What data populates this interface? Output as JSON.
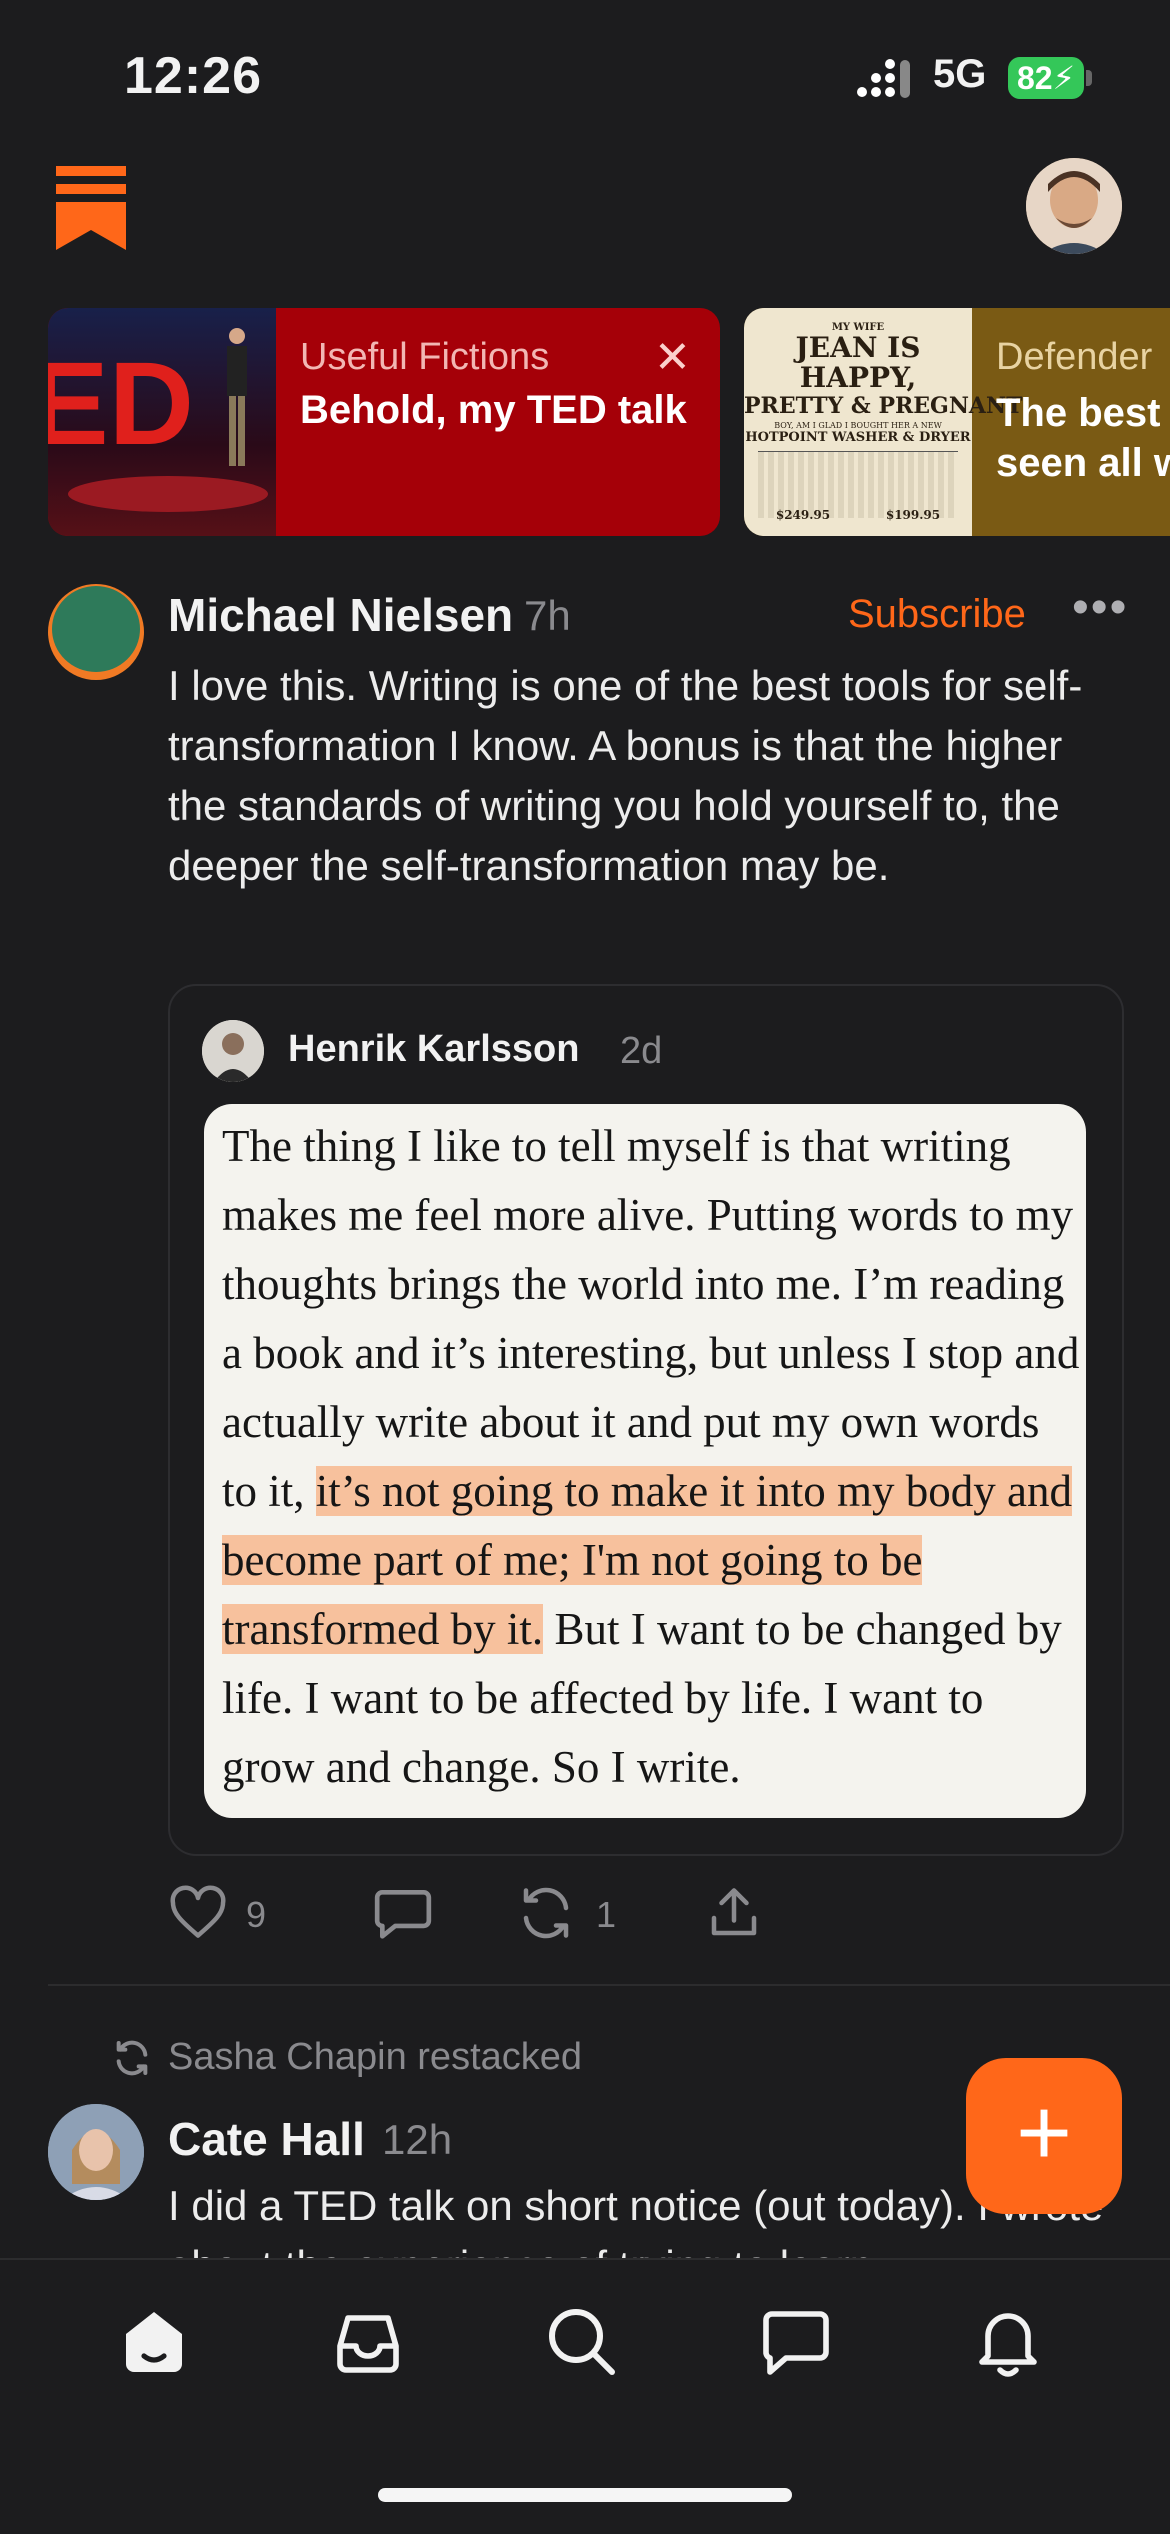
{
  "status_bar": {
    "time": "12:26",
    "network": "5G",
    "battery": "82"
  },
  "featured_cards": [
    {
      "publication": "Useful Fictions",
      "title": "Behold, my TED talk",
      "thumb_text": "ED",
      "close": "✕"
    },
    {
      "publication": "Defender",
      "title_line1": "The best",
      "title_line2": "seen all w",
      "ad_lines": [
        "MY WIFE",
        "JEAN IS HAPPY,",
        "PRETTY & PREGNANT",
        "BOY, AM I GLAD I BOUGHT HER A NEW",
        "HOTPOINT WASHER & DRYER",
        "$249.95",
        "$199.95"
      ]
    }
  ],
  "post": {
    "author": "Michael Nielsen",
    "time_ago": "7h",
    "subscribe_label": "Subscribe",
    "more_label": "•••",
    "text": "I love this. Writing is one of the best tools for self-transformation I know. A bonus is that the higher the standards of writing you hold yourself to, the deeper the self-transformation may be.",
    "quote": {
      "author": "Henrik Karlsson",
      "time_ago": "2d",
      "text_before": "The thing I like to tell myself is that writing makes me feel more alive. Putting words to my thoughts brings the world into me. I’m reading a book and it’s interesting, but unless I stop and actually write about it and put my own words to it, ",
      "text_highlight": "it’s not going to make it into my body and become part of me; I'm not going to be transformed by it.",
      "text_after": " But I want to be changed by life. I want to be affected by life. I want to grow and change. So I write."
    },
    "actions": {
      "likes": "9",
      "restacks": "1"
    }
  },
  "post2": {
    "restack_label": "Sasha Chapin restacked",
    "author": "Cate Hall",
    "time_ago": "12h",
    "text": "I did a TED talk on short notice (out today). I wrote about the experience of trying to learn"
  },
  "fab_label": "+",
  "tabs": [
    "home-icon",
    "inbox-icon",
    "search-icon",
    "chat-icon",
    "bell-icon"
  ],
  "colors": {
    "accent": "#ff6719",
    "background": "#1c1c1e",
    "highlight": "#f7c19d"
  }
}
